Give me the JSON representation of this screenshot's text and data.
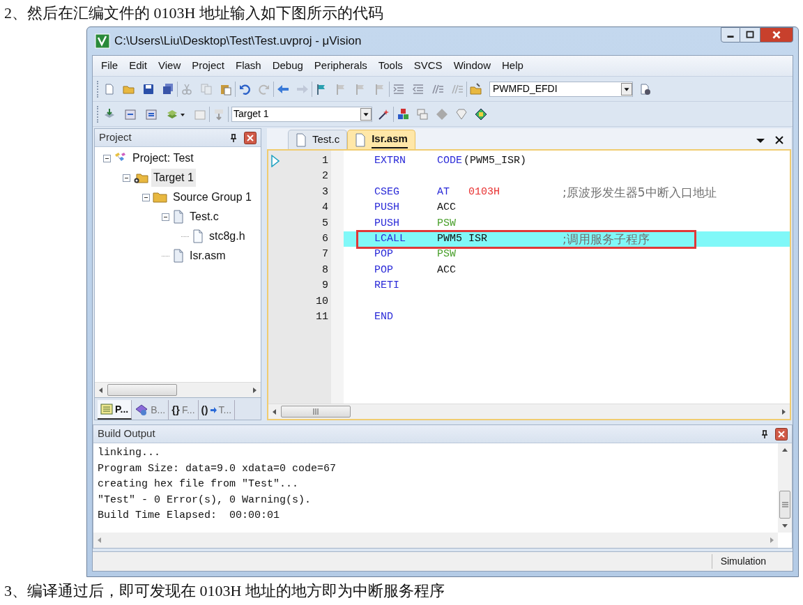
{
  "doc": {
    "heading": "2、然后在汇编文件的 0103H 地址输入如下图所示的代码",
    "footer": "3、编译通过后，即可发现在 0103H 地址的地方即为中断服务程序"
  },
  "window": {
    "title": "C:\\Users\\Liu\\Desktop\\Test\\Test.uvproj - μVision"
  },
  "menu": [
    "File",
    "Edit",
    "View",
    "Project",
    "Flash",
    "Debug",
    "Peripherals",
    "Tools",
    "SVCS",
    "Window",
    "Help"
  ],
  "toolbar": {
    "device_dropdown": "PWMFD_EFDI",
    "target_dropdown": "Target 1"
  },
  "project_panel": {
    "title": "Project",
    "tree": [
      {
        "label": "Project: Test",
        "kind": "project",
        "expanded": true,
        "selected": false,
        "children": [
          {
            "label": "Target 1",
            "kind": "target",
            "expanded": true,
            "selected": true,
            "children": [
              {
                "label": "Source Group 1",
                "kind": "group",
                "expanded": true,
                "selected": false,
                "children": [
                  {
                    "label": "Test.c",
                    "kind": "file",
                    "expanded": true,
                    "selected": false,
                    "children": [
                      {
                        "label": "stc8g.h",
                        "kind": "header",
                        "selected": false
                      }
                    ]
                  },
                  {
                    "label": "Isr.asm",
                    "kind": "file",
                    "selected": false
                  }
                ]
              }
            ]
          }
        ]
      }
    ],
    "tabs": [
      {
        "label": "P...",
        "kind": "project",
        "selected": true
      },
      {
        "label": "B...",
        "kind": "books",
        "selected": false
      },
      {
        "label": "F...",
        "glyph": "{}",
        "kind": "functions",
        "selected": false
      },
      {
        "label": "T...",
        "glyph": "()",
        "kind": "templates",
        "selected": false
      }
    ]
  },
  "editor": {
    "tabs": [
      {
        "label": "Test.c",
        "selected": false
      },
      {
        "label": "Isr.asm",
        "selected": true
      }
    ],
    "lines": [
      {
        "number": "1",
        "mnemonic": "EXTRN",
        "operands": [
          {
            "text": "CODE",
            "kind": "keyword"
          }
        ],
        "argument": "(PWM5_ISR)",
        "marker": true,
        "highlighted": false,
        "boxed": false
      },
      {
        "number": "2",
        "marker": false,
        "highlighted": false,
        "boxed": false
      },
      {
        "number": "3",
        "mnemonic": "CSEG",
        "operands": [
          {
            "text": "AT",
            "kind": "keyword"
          },
          {
            "text": "0103H",
            "kind": "number"
          }
        ],
        "comment": ";原波形发生器5中断入口地址",
        "marker": false,
        "highlighted": false,
        "boxed": false
      },
      {
        "number": "4",
        "mnemonic": "PUSH",
        "operands": [
          {
            "text": "ACC",
            "kind": "plain"
          }
        ],
        "marker": false,
        "highlighted": false,
        "boxed": false
      },
      {
        "number": "5",
        "mnemonic": "PUSH",
        "operands": [
          {
            "text": "PSW",
            "kind": "register"
          }
        ],
        "marker": false,
        "highlighted": false,
        "boxed": false
      },
      {
        "number": "6",
        "mnemonic": "LCALL",
        "operands": [
          {
            "text": "PWM5 ISR",
            "kind": "plain"
          }
        ],
        "comment": ";调用服务子程序",
        "marker": false,
        "highlighted": true,
        "boxed": true
      },
      {
        "number": "7",
        "mnemonic": "POP",
        "operands": [
          {
            "text": "PSW",
            "kind": "register"
          }
        ],
        "marker": false,
        "highlighted": false,
        "boxed": false
      },
      {
        "number": "8",
        "mnemonic": "POP",
        "operands": [
          {
            "text": "ACC",
            "kind": "plain"
          }
        ],
        "marker": false,
        "highlighted": false,
        "boxed": false
      },
      {
        "number": "9",
        "mnemonic": "RETI",
        "marker": false,
        "highlighted": false,
        "boxed": false
      },
      {
        "number": "10",
        "marker": false,
        "highlighted": false,
        "boxed": false
      },
      {
        "number": "11",
        "mnemonic": "END",
        "marker": false,
        "highlighted": false,
        "boxed": false
      }
    ]
  },
  "build_output": {
    "title": "Build Output",
    "lines": [
      "linking...",
      "Program Size: data=9.0 xdata=0 code=67",
      "creating hex file from \"Test\"...",
      "\"Test\" - 0 Error(s), 0 Warning(s).",
      "Build Time Elapsed:  00:00:01"
    ]
  },
  "status_bar": {
    "mode": "Simulation"
  }
}
